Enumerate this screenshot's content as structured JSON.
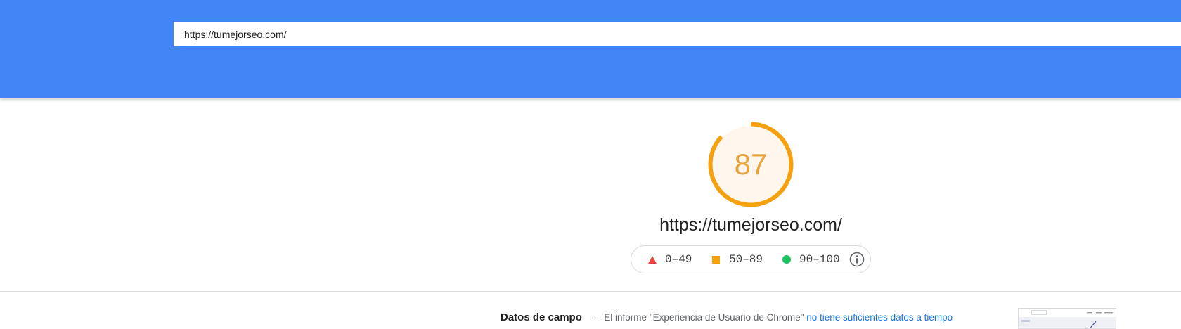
{
  "header": {
    "url_input": {
      "value": "https://tumejorseo.com/",
      "placeholder": ""
    },
    "color": "#4285f4"
  },
  "score": {
    "value": "87",
    "fraction": 0.87,
    "color": "#f5a00f",
    "text_color": "#e8a23a",
    "fill_color": "#fff7ed"
  },
  "audited_url": "https://tumejorseo.com/",
  "legend": {
    "items": [
      {
        "icon": "triangle-fail-icon",
        "label": "0–49",
        "color": "#e5483a"
      },
      {
        "icon": "square-average-icon",
        "label": "50–89",
        "color": "#f5a00f"
      },
      {
        "icon": "circle-pass-icon",
        "label": "90–100",
        "color": "#17c45f"
      }
    ],
    "info_icon": "info-icon"
  },
  "field_data": {
    "title": "Datos de campo",
    "dash": "—",
    "description": "El informe \"Experiencia de Usuario de Chrome\"",
    "link": "no tiene suficientes datos a tiempo"
  },
  "thumbnail": {
    "icon": "page-screenshot-thumbnail"
  }
}
